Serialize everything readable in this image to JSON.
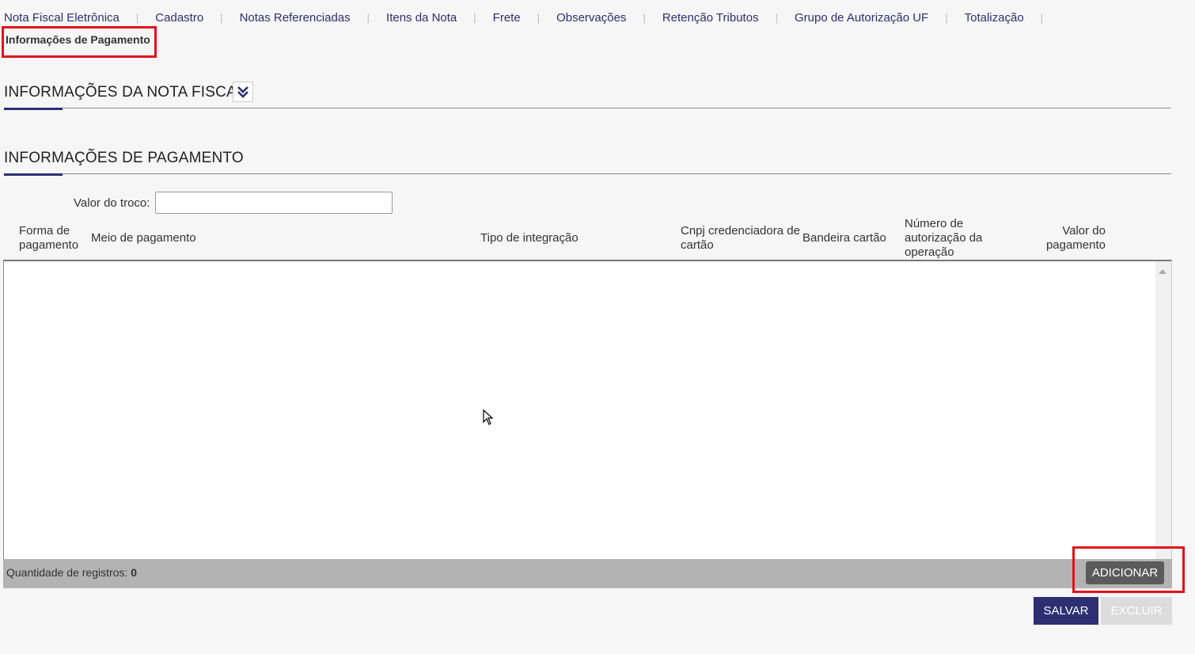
{
  "tabs": [
    {
      "label": "Nota Fiscal Eletrônica"
    },
    {
      "label": "Cadastro"
    },
    {
      "label": "Notas Referenciadas"
    },
    {
      "label": "Itens da Nota"
    },
    {
      "label": "Frete"
    },
    {
      "label": "Observações"
    },
    {
      "label": "Retenção Tributos"
    },
    {
      "label": "Grupo de Autorização UF"
    },
    {
      "label": "Totalização"
    }
  ],
  "active_tab": {
    "label": "Informações de Pagamento"
  },
  "sections": {
    "nota_fiscal": {
      "title": "INFORMAÇÕES DA NOTA FISCAL",
      "toggle_icon": "double-chevron-down-icon"
    },
    "pagamento": {
      "title": "INFORMAÇÕES DE PAGAMENTO"
    }
  },
  "troco": {
    "label": "Valor do troco:",
    "value": ""
  },
  "table": {
    "columns": [
      {
        "l1": "Forma de",
        "l2": "pagamento"
      },
      {
        "l1": "Meio de pagamento"
      },
      {
        "l1": "Tipo de integração"
      },
      {
        "l1": "Cnpj credenciadora de",
        "l2": "cartão"
      },
      {
        "l1": "Bandeira cartão"
      },
      {
        "l1": "Número de",
        "l2": "autorização da",
        "l3": "operação"
      },
      {
        "l1": "Valor do",
        "l2": "pagamento"
      }
    ],
    "rows": []
  },
  "footer": {
    "count_label": "Quantidade de registros:",
    "count_value": "0",
    "add_label": "ADICIONAR"
  },
  "actions": {
    "save_label": "SALVAR",
    "delete_label": "EXCLUIR"
  },
  "colors": {
    "brand": "#2d2f73",
    "highlight": "#e3101c",
    "footer_bar": "#b3b3b3"
  }
}
